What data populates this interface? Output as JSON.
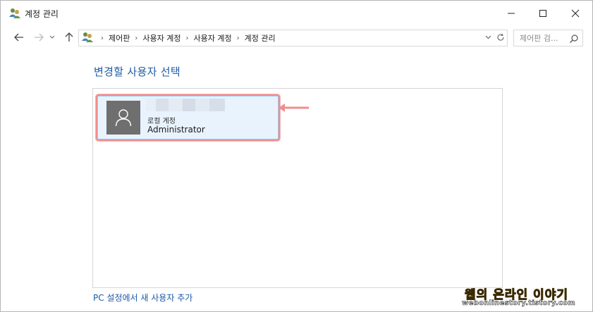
{
  "window": {
    "title": "계정 관리",
    "controls": {
      "minimize": "minimize",
      "maximize": "maximize",
      "close": "close"
    }
  },
  "nav": {
    "breadcrumbs": [
      "제어판",
      "사용자 계정",
      "사용자 계정",
      "계정 관리"
    ],
    "search_placeholder": "제어판 검..."
  },
  "main": {
    "heading": "변경할 사용자 선택",
    "accounts": [
      {
        "type": "로컬 계정",
        "role": "Administrator",
        "selected": true
      }
    ],
    "add_user_link": "PC 설정에서 새 사용자 추가"
  },
  "watermark": {
    "title": "웹의 온라인 이야기",
    "url": "webonlinestory.tistory.com"
  },
  "colors": {
    "accent_link": "#1e5aa8",
    "tile_bg": "#e9f3fd",
    "highlight": "#ef8e8e"
  }
}
